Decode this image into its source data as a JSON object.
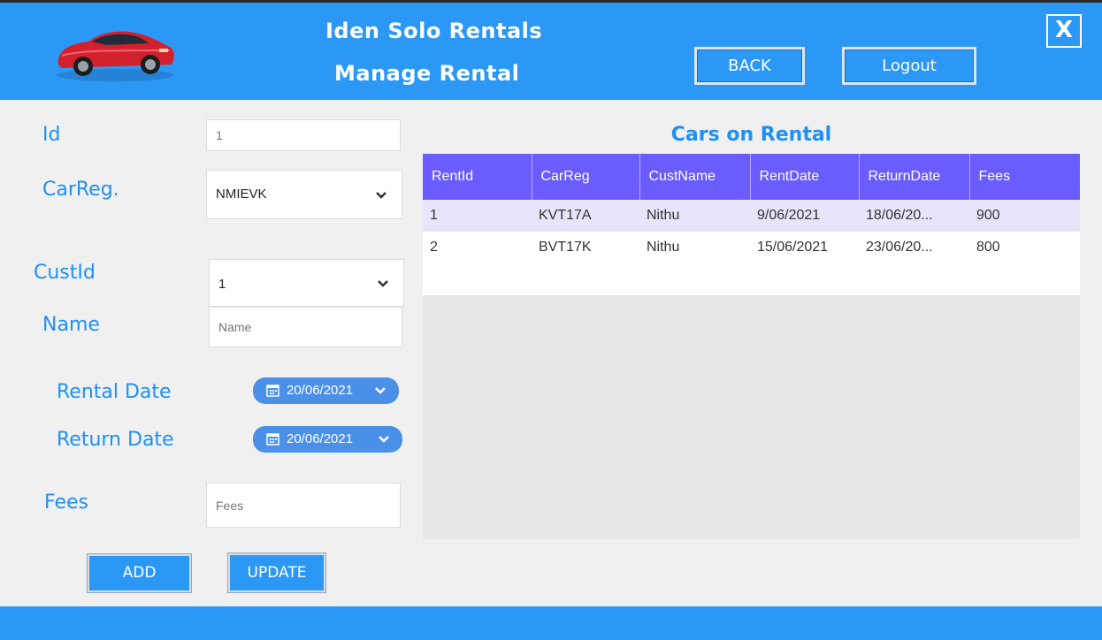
{
  "header": {
    "title_line1": "Iden Solo Rentals",
    "title_line2": "Manage Rental",
    "back_label": "BACK",
    "logout_label": "Logout",
    "close_label": "X"
  },
  "form": {
    "id_label": "Id",
    "id_value": "1",
    "carreg_label": "CarReg.",
    "carreg_value": "NMIEVK",
    "custid_label": "CustId",
    "custid_value": "1",
    "name_label": "Name",
    "name_placeholder": "Name",
    "rental_date_label": "Rental Date",
    "rental_date_value": "20/06/2021",
    "return_date_label": "Return Date",
    "return_date_value": "20/06/2021",
    "fees_label": "Fees",
    "fees_placeholder": "Fees",
    "add_label": "ADD",
    "update_label": "UPDATE"
  },
  "grid": {
    "title": "Cars on Rental",
    "columns": [
      "RentId",
      "CarReg",
      "CustName",
      "RentDate",
      "ReturnDate",
      "Fees"
    ],
    "rows": [
      [
        "1",
        "KVT17A",
        "Nithu",
        "9/06/2021",
        "18/06/20...",
        "900"
      ],
      [
        "2",
        "BVT17K",
        "Nithu",
        "15/06/2021",
        "23/06/20...",
        "800"
      ]
    ]
  },
  "colors": {
    "header_blue": "#2b98f5",
    "label_blue": "#1e90f5",
    "grid_header": "#6a5cff",
    "selected_row": "#e7e4fc"
  }
}
